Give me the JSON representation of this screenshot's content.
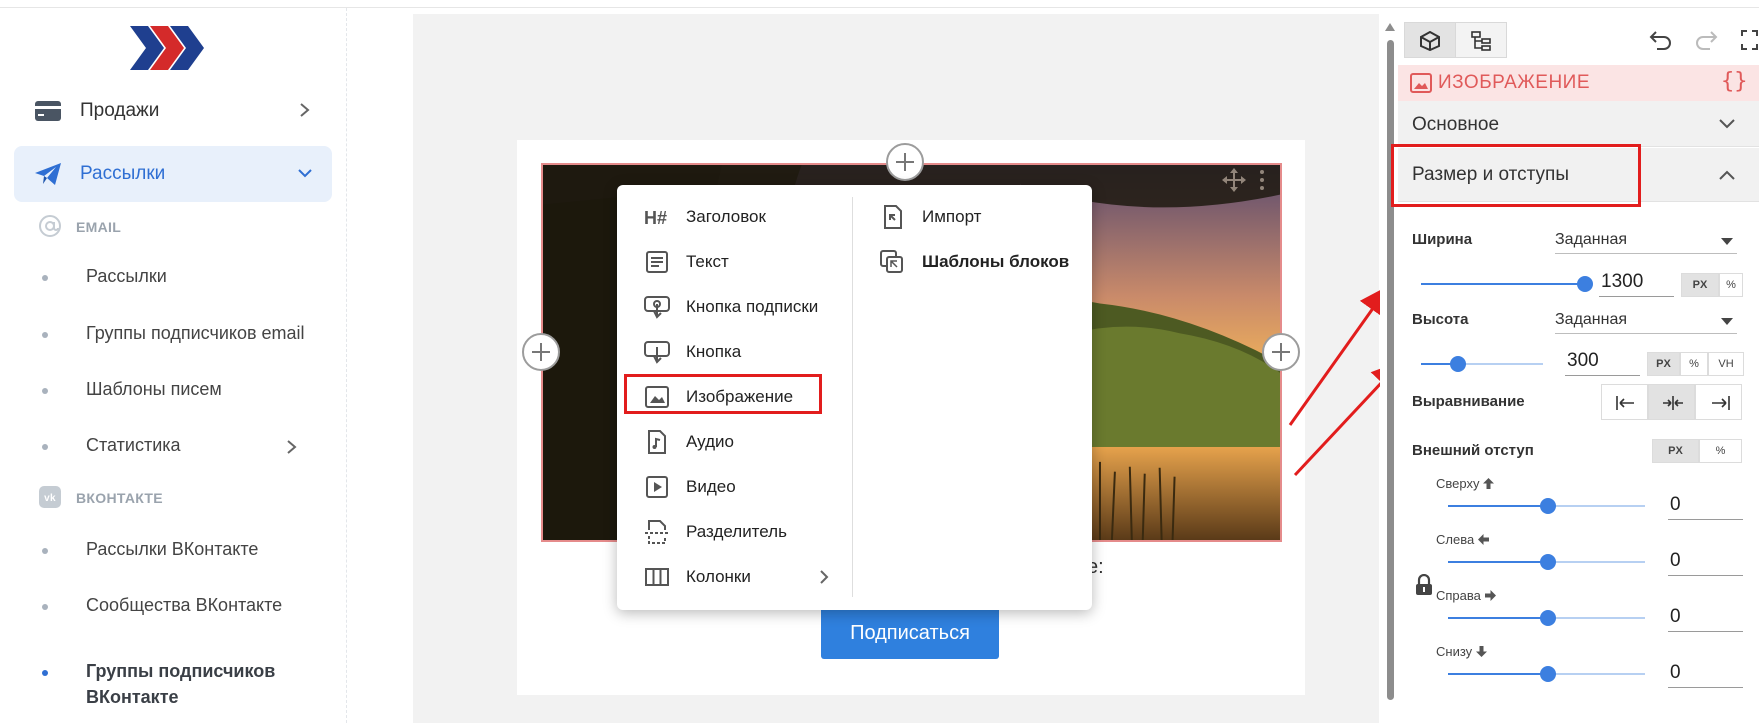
{
  "sidebar": {
    "logo": "logo-chevrons",
    "nav": [
      {
        "label": "Продажи",
        "icon": "card-icon",
        "active": false
      },
      {
        "label": "Рассылки",
        "icon": "paper-plane-icon",
        "active": true
      }
    ],
    "sections": [
      {
        "title": "EMAIL",
        "icon": "at-icon",
        "items": [
          {
            "label": "Рассылки"
          },
          {
            "label": "Группы подписчиков email"
          },
          {
            "label": "Шаблоны писем"
          },
          {
            "label": "Статистика",
            "has_submenu": true
          }
        ]
      },
      {
        "title": "ВКОНТАКТЕ",
        "icon": "vk-icon",
        "items": [
          {
            "label": "Рассылки ВКонтакте"
          },
          {
            "label": "Сообщества ВКонтакте"
          },
          {
            "label": "Группы подписчиков ВКонтакте",
            "active": true
          }
        ]
      }
    ]
  },
  "editor": {
    "partial_text": "ке:",
    "subscribe_button": "Подписаться",
    "menu": {
      "left": [
        {
          "label": "Заголовок",
          "icon": "heading-icon"
        },
        {
          "label": "Текст",
          "icon": "text-icon"
        },
        {
          "label": "Кнопка подписки",
          "icon": "subscribe-button-icon"
        },
        {
          "label": "Кнопка",
          "icon": "button-icon"
        },
        {
          "label": "Изображение",
          "icon": "image-icon",
          "highlighted": true
        },
        {
          "label": "Аудио",
          "icon": "audio-icon"
        },
        {
          "label": "Видео",
          "icon": "video-icon"
        },
        {
          "label": "Разделитель",
          "icon": "divider-icon"
        },
        {
          "label": "Колонки",
          "icon": "columns-icon",
          "has_submenu": true
        }
      ],
      "right": [
        {
          "label": "Импорт",
          "icon": "import-icon",
          "bold": false
        },
        {
          "label": "Шаблоны блоков",
          "icon": "block-templates-icon",
          "bold": true
        }
      ]
    }
  },
  "panel": {
    "block_title": "ИЗОБРАЖЕНИЕ",
    "braces": "{}",
    "sections": [
      {
        "label": "Основное",
        "expanded": false
      },
      {
        "label": "Размер и отступы",
        "expanded": true
      }
    ],
    "width": {
      "label": "Ширина",
      "mode": "Заданная",
      "value": "1300",
      "units": [
        "PX",
        "%"
      ],
      "selected_unit": "PX",
      "slider_level": 1.0
    },
    "height": {
      "label": "Высота",
      "mode": "Заданная",
      "value": "300",
      "units": [
        "PX",
        "%",
        "VH"
      ],
      "selected_unit": "PX",
      "slider_level": 0.3
    },
    "align": {
      "label": "Выравнивание",
      "options": [
        "left",
        "center",
        "right"
      ],
      "selected": "center"
    },
    "margin": {
      "label": "Внешний отступ",
      "units": [
        "PX",
        "%"
      ],
      "selected_unit": "PX",
      "sides": [
        {
          "label": "Сверху",
          "icon": "arrow-up-icon",
          "value": "0"
        },
        {
          "label": "Слева",
          "icon": "arrow-left-icon",
          "value": "0"
        },
        {
          "label": "Справа",
          "icon": "arrow-right-icon",
          "value": "0"
        },
        {
          "label": "Снизу",
          "icon": "arrow-down-icon",
          "value": "0"
        }
      ]
    }
  },
  "colors": {
    "accent": "#2f6fd3",
    "highlight_red": "#e21d1d",
    "button_blue": "#2f80de",
    "panel_title": "#e05a5a"
  }
}
